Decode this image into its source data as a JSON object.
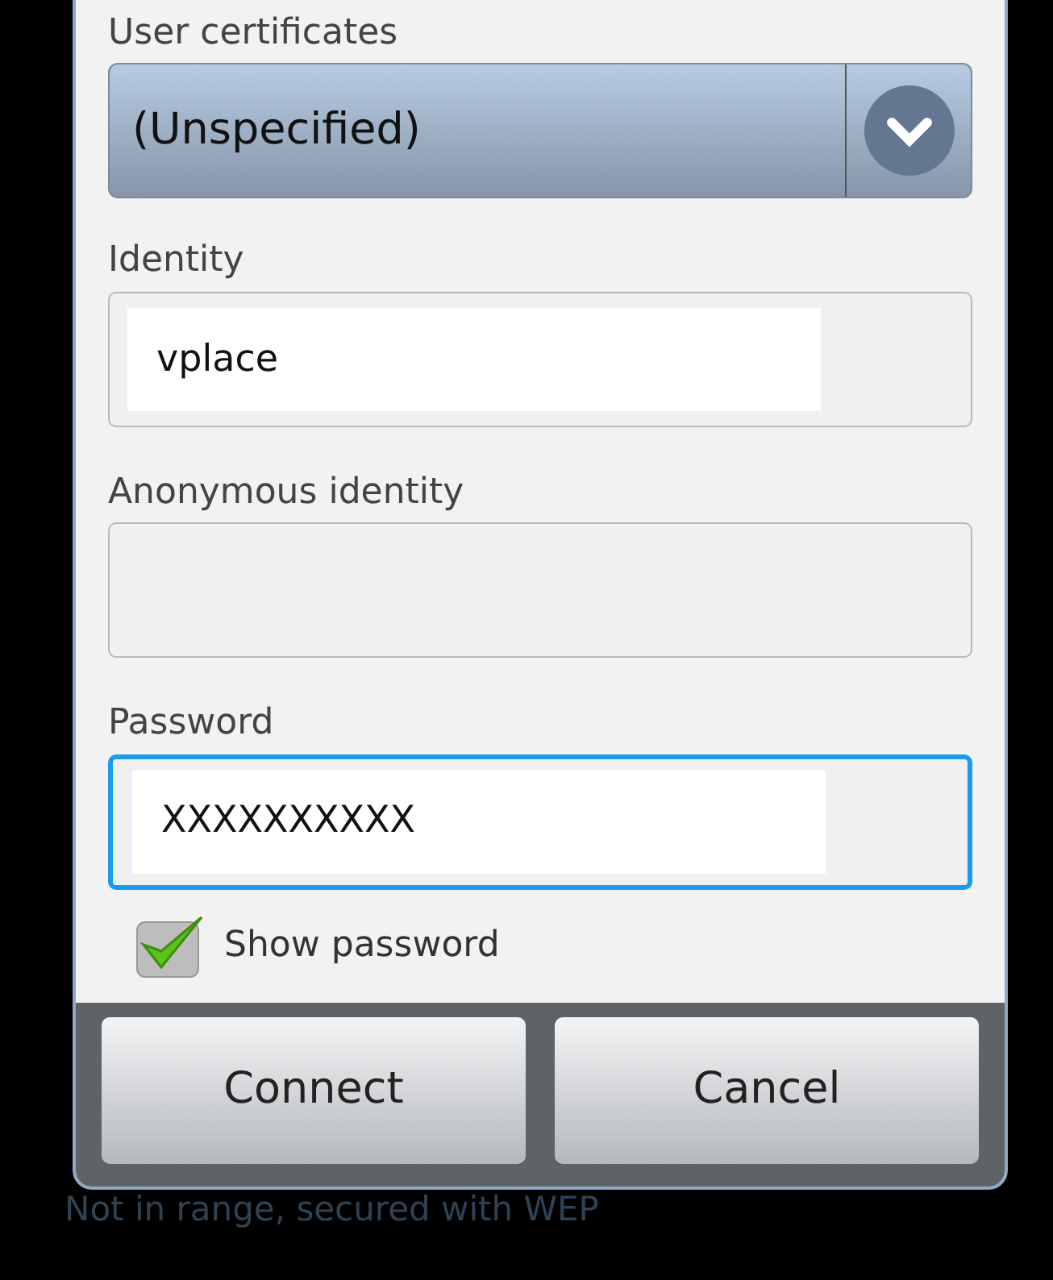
{
  "dialog": {
    "fields": [
      {
        "kind": "spinner",
        "label": "User certificates",
        "value": "(Unspecified)"
      },
      {
        "kind": "text",
        "label": "Identity",
        "value": "vplace",
        "focused": false
      },
      {
        "kind": "text",
        "label": "Anonymous identity",
        "focused": false
      },
      {
        "kind": "text",
        "label": "Password",
        "value": "XXXXXXXXXX",
        "focused": true
      }
    ],
    "show_password": {
      "label": "Show password",
      "checked": true
    },
    "buttons": [
      "Connect",
      "Cancel"
    ]
  },
  "background_list": {
    "status": "Not in range, secured with WEP"
  }
}
